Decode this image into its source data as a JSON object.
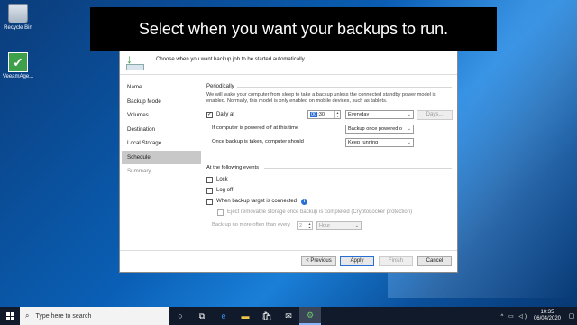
{
  "banner": {
    "text": "Select when you want your backups to run."
  },
  "desktop": {
    "icons": [
      {
        "label": "Recycle Bin"
      },
      {
        "label": "VeeamAge..."
      }
    ]
  },
  "dialog": {
    "description": "Choose when you want backup job to be started automatically.",
    "nav": [
      {
        "label": "Name"
      },
      {
        "label": "Backup Mode"
      },
      {
        "label": "Volumes"
      },
      {
        "label": "Destination"
      },
      {
        "label": "Local Storage"
      },
      {
        "label": "Schedule"
      },
      {
        "label": "Summary"
      }
    ],
    "periodically": {
      "title": "Periodically",
      "text": "We will wake your computer from sleep to take a backup unless the connected standby power model is enabled. Normally, this model is only enabled on mobile devices, such as tablets.",
      "daily_label": "Daily at",
      "time_hour": "00",
      "time_min": ":30",
      "frequency": "Everyday",
      "days_button": "Days...",
      "powered_off_label": "If computer is powered off at this time",
      "powered_off_value": "Backup once powered o",
      "after_backup_label": "Once backup is taken, computer should",
      "after_backup_value": "Keep running"
    },
    "events": {
      "title": "At the following events",
      "lock": "Lock",
      "logoff": "Log off",
      "target_connected": "When backup target is connected",
      "eject": "Eject removable storage once backup is completed (CryptoLocker protection)",
      "limit_label": "Back up no more often than every",
      "limit_value": "2",
      "limit_unit": "Hour"
    },
    "buttons": {
      "previous": "< Previous",
      "apply": "Apply",
      "finish": "Finish",
      "cancel": "Cancel"
    }
  },
  "taskbar": {
    "search_placeholder": "Type here to search",
    "time": "10:35",
    "date": "06/04/2020"
  }
}
